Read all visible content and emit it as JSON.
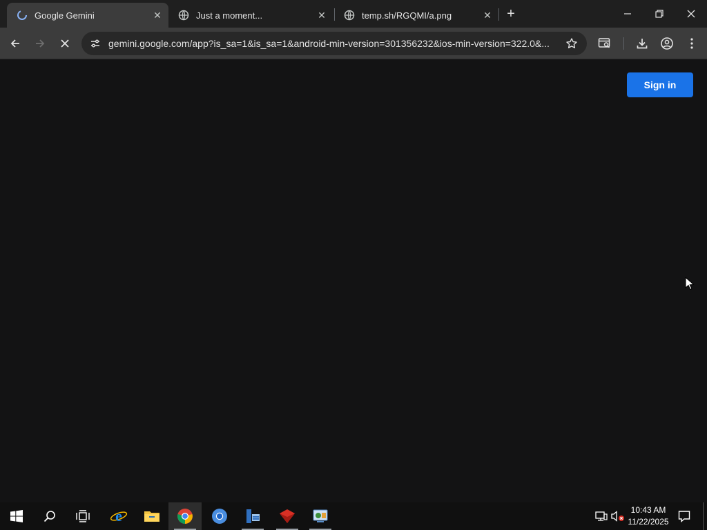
{
  "browser": {
    "tabs": [
      {
        "title": "Google Gemini",
        "active": true,
        "loading": true
      },
      {
        "title": "Just a moment...",
        "active": false
      },
      {
        "title": "temp.sh/RGQMI/a.png",
        "active": false
      }
    ],
    "new_tab_icon": "plus-icon",
    "address_bar": {
      "url": "gemini.google.com/app?is_sa=1&is_sa=1&android-min-version=301356232&ios-min-version=322.0&..."
    },
    "toolbar_icons": [
      "back-arrow-icon",
      "forward-arrow-icon",
      "stop-loading-icon",
      "site-info-icon",
      "star-icon",
      "tab-search-icon",
      "download-icon",
      "profile-icon",
      "more-menu-icon"
    ]
  },
  "page": {
    "sign_in_label": "Sign in"
  },
  "taskbar": {
    "time": "10:43 AM",
    "date": "11/22/2025",
    "apps": [
      "start-icon",
      "search-icon",
      "task-view-icon",
      "internet-explorer-icon",
      "file-explorer-icon",
      "chrome-icon",
      "chromium-icon",
      "server-manager-icon",
      "red-app-icon",
      "control-panel-icon"
    ]
  },
  "colors": {
    "content_bg": "#131314",
    "tabstrip_bg": "#1f1f1f",
    "toolbar_bg": "#3c3c3c",
    "signin_bg": "#1a73e8",
    "taskbar_bg": "#101010"
  }
}
